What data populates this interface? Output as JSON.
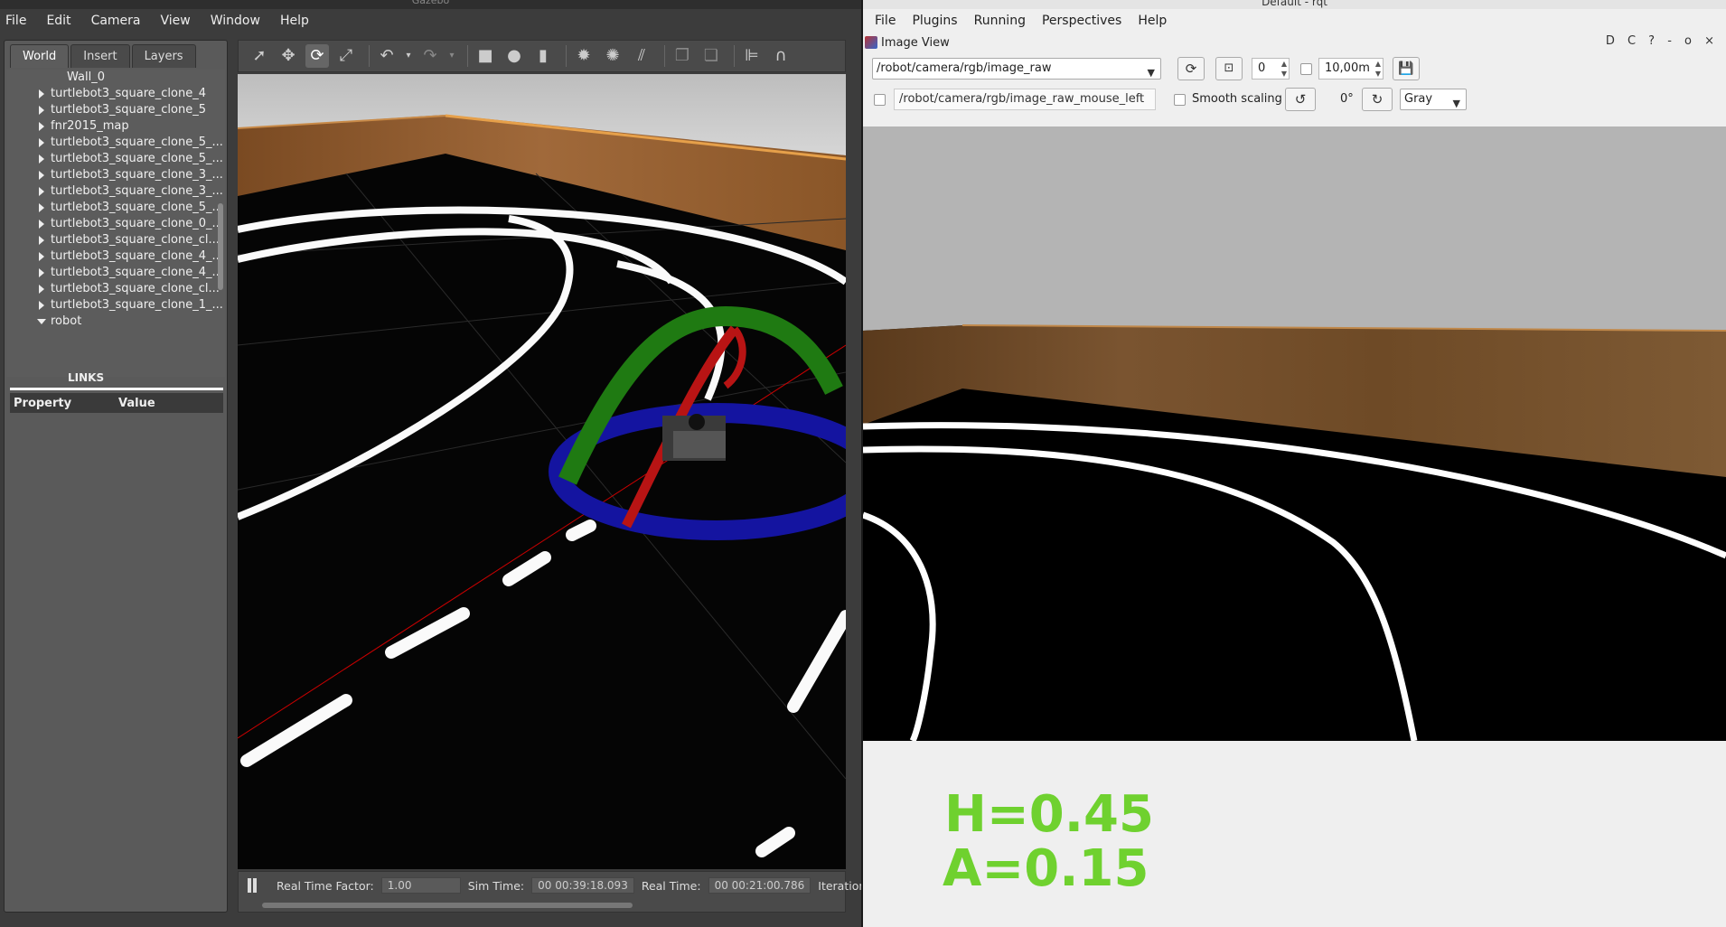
{
  "gazebo": {
    "title": "Gazebo",
    "menu": [
      "File",
      "Edit",
      "Camera",
      "View",
      "Window",
      "Help"
    ],
    "tabs": [
      "World",
      "Insert",
      "Layers"
    ],
    "active_tab": "World",
    "tree": [
      {
        "label": "Wall_0",
        "arrow": "none"
      },
      {
        "label": "turtlebot3_square_clone_4",
        "arrow": "right"
      },
      {
        "label": "turtlebot3_square_clone_5",
        "arrow": "right"
      },
      {
        "label": "fnr2015_map",
        "arrow": "right"
      },
      {
        "label": "turtlebot3_square_clone_5_...",
        "arrow": "right"
      },
      {
        "label": "turtlebot3_square_clone_5_...",
        "arrow": "right"
      },
      {
        "label": "turtlebot3_square_clone_3_...",
        "arrow": "right"
      },
      {
        "label": "turtlebot3_square_clone_3_...",
        "arrow": "right"
      },
      {
        "label": "turtlebot3_square_clone_5_...",
        "arrow": "right"
      },
      {
        "label": "turtlebot3_square_clone_0_...",
        "arrow": "right"
      },
      {
        "label": "turtlebot3_square_clone_cl...",
        "arrow": "right"
      },
      {
        "label": "turtlebot3_square_clone_4_...",
        "arrow": "right"
      },
      {
        "label": "turtlebot3_square_clone_4_...",
        "arrow": "right"
      },
      {
        "label": "turtlebot3_square_clone_cl...",
        "arrow": "right"
      },
      {
        "label": "turtlebot3_square_clone_1_...",
        "arrow": "right"
      },
      {
        "label": "robot",
        "arrow": "down"
      }
    ],
    "links_label": "LINKS",
    "property_header": "Property",
    "value_header": "Value",
    "bottom": {
      "rtf_label": "Real Time Factor:",
      "rtf_value": "1.00",
      "sim_time_label": "Sim Time:",
      "sim_time_value": "00 00:39:18.093",
      "real_time_label": "Real Time:",
      "real_time_value": "00 00:21:00.786",
      "iterations_label": "Iteration"
    }
  },
  "rqt": {
    "title": "Default - rqt",
    "menu": [
      "File",
      "Plugins",
      "Running",
      "Perspectives",
      "Help"
    ],
    "plugin_title": "Image View",
    "dock_buttons": "D C ? - o ×",
    "topic": "/robot/camera/rgb/image_raw",
    "num_gridlines": "0",
    "max_range": "10,00m",
    "mouse_topic": "/robot/camera/rgb/image_raw_mouse_left",
    "smooth_scaling_label": "Smooth scaling",
    "rotation": "0°",
    "color_scheme": "Gray",
    "overlay_h": "H=0.45",
    "overlay_a": "A=0.15"
  },
  "colors": {
    "overlay_green": "#6fd12f",
    "gizmo_green": "#1f7a12",
    "gizmo_red": "#b81414",
    "gizmo_blue": "#1414a0"
  }
}
